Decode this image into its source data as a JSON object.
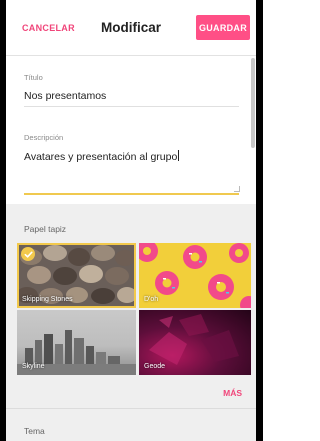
{
  "header": {
    "cancel_label": "CANCELAR",
    "title": "Modificar",
    "save_label": "GUARDAR"
  },
  "form": {
    "title_label": "Título",
    "title_value": "Nos presentamos",
    "description_label": "Descripción",
    "description_value": "Avatares y presentación al grupo"
  },
  "wallpaper": {
    "section_label": "Papel tapiz",
    "tiles": [
      {
        "label": "Skipping Stones",
        "selected": true
      },
      {
        "label": "D'oh",
        "selected": false
      },
      {
        "label": "Skyline",
        "selected": false
      },
      {
        "label": "Geode",
        "selected": false
      }
    ],
    "more_label": "MÁS"
  },
  "theme": {
    "section_label": "Tema"
  },
  "colors": {
    "accent": "#f0457a",
    "save_bg": "#ff4f86",
    "focus_underline": "#f0c94f",
    "selected_outline": "#f2c94c"
  },
  "icons": {
    "selected_check": "check-icon"
  }
}
